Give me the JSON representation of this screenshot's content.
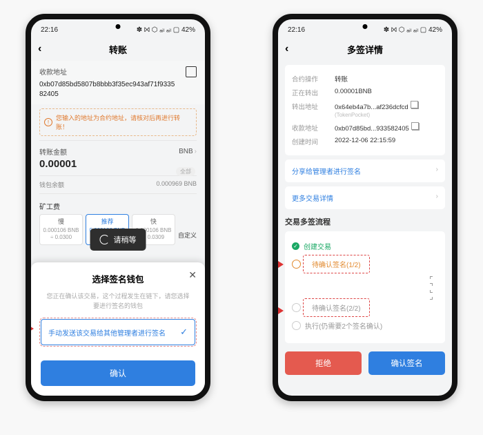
{
  "status": {
    "time": "22:16",
    "indicators": "✽ ⨝ ⬡ ₐᵢₗ ₐᵢₗ ▢ 42%"
  },
  "left": {
    "title": "转账",
    "recvLabel": "收款地址",
    "recvAddr": "0xb07d85bd5807b8bbb3f35ec943af71f933582405",
    "warn": "您输入的地址为合约地址，请核对后再进行转账！",
    "amountLabel": "转账金额",
    "unit": "BNB",
    "amount": "0.00001",
    "allIn": "全部",
    "balanceLabel": "钱包余额",
    "balance": "0.000969 BNB",
    "feeLabel": "矿工费",
    "feeOpts": [
      {
        "name": "慢",
        "l1": "0.000106 BNB",
        "l2": "÷ 0.0300"
      },
      {
        "name": "推荐",
        "l1": "0.000106 BNB",
        "l2": "÷ 0.0304"
      },
      {
        "name": "快",
        "l1": "0.000106 BNB",
        "l2": "÷ 0.0309"
      }
    ],
    "feeCustom": "自定义",
    "toast": "请稍等",
    "sheet": {
      "title": "选择签名钱包",
      "hint": "您正在确认该交易，这个过程发生在链下，请您选择要进行签名的钱包",
      "option": "手动发送该交易给其他管理者进行签名",
      "confirm": "确认"
    }
  },
  "right": {
    "title": "多签详情",
    "rows": {
      "op": {
        "k": "合约操作",
        "v": "转账"
      },
      "nowOut": {
        "k": "正在转出",
        "v": "0.00001BNB"
      },
      "outAddr": {
        "k": "转出地址",
        "v": "0x64eb4a7b...af236dcfcd",
        "sub": "(TokenPocket)"
      },
      "recvAddr": {
        "k": "收款地址",
        "v": "0xb07d85bd...933582405"
      },
      "time": {
        "k": "创建时间",
        "v": "2022-12-06 22:15:59"
      }
    },
    "link1": "分享给管理者进行签名",
    "link2": "更多交易详情",
    "flowTitle": "交易多签流程",
    "flow": {
      "s1": "创建交易",
      "s2": "待确认签名(1/2)",
      "s3": "待确认签名(2/2)",
      "s4": "执行(仍需要2个签名确认)"
    },
    "reject": "拒绝",
    "confirm": "确认签名"
  }
}
